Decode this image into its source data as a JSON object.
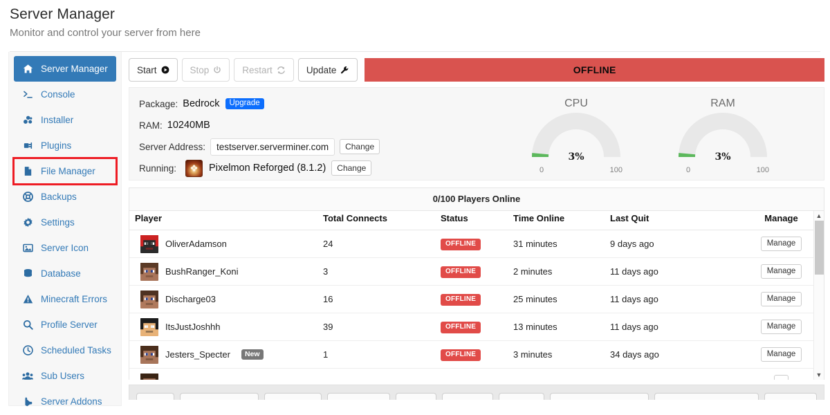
{
  "header": {
    "title": "Server Manager",
    "subtitle": "Monitor and control your server from here"
  },
  "sidebar": {
    "items": [
      {
        "label": "Server Manager",
        "icon": "home-icon",
        "state": "active"
      },
      {
        "label": "Console",
        "icon": "terminal-icon",
        "state": "normal"
      },
      {
        "label": "Installer",
        "icon": "cubes-icon",
        "state": "normal"
      },
      {
        "label": "Plugins",
        "icon": "plug-icon",
        "state": "normal"
      },
      {
        "label": "File Manager",
        "icon": "file-icon",
        "state": "flagged"
      },
      {
        "label": "Backups",
        "icon": "lifebuoy-icon",
        "state": "normal"
      },
      {
        "label": "Settings",
        "icon": "gear-icon",
        "state": "normal"
      },
      {
        "label": "Server Icon",
        "icon": "image-icon",
        "state": "normal"
      },
      {
        "label": "Database",
        "icon": "database-icon",
        "state": "normal"
      },
      {
        "label": "Minecraft Errors",
        "icon": "warning-icon",
        "state": "normal"
      },
      {
        "label": "Profile Server",
        "icon": "search-icon",
        "state": "normal"
      },
      {
        "label": "Scheduled Tasks",
        "icon": "clock-icon",
        "state": "normal"
      },
      {
        "label": "Sub Users",
        "icon": "users-icon",
        "state": "normal"
      },
      {
        "label": "Server Addons",
        "icon": "puzzle-icon",
        "state": "normal"
      }
    ]
  },
  "toolbar": {
    "start_label": "Start",
    "stop_label": "Stop",
    "restart_label": "Restart",
    "update_label": "Update",
    "status_text": "OFFLINE",
    "status_color": "#d9534f"
  },
  "info": {
    "package_label": "Package:",
    "package_value": "Bedrock",
    "upgrade_badge": "Upgrade",
    "ram_label": "RAM:",
    "ram_value": "10240MB",
    "address_label": "Server Address:",
    "address_value": "testserver.serverminer.com",
    "address_change_label": "Change",
    "running_label": "Running:",
    "running_value": "Pixelmon Reforged (8.1.2)",
    "running_change_label": "Change"
  },
  "gauges": [
    {
      "title": "CPU",
      "value": "3%",
      "percent": 3,
      "min_label": "0",
      "max_label": "100",
      "color": "#5cb85c"
    },
    {
      "title": "RAM",
      "value": "3%",
      "percent": 3,
      "min_label": "0",
      "max_label": "100",
      "color": "#5cb85c"
    }
  ],
  "players": {
    "online_summary": "0/100 Players Online",
    "columns": [
      "Player",
      "Total Connects",
      "Status",
      "Time Online",
      "Last Quit",
      "Manage"
    ],
    "manage_label": "Manage",
    "rows": [
      {
        "name": "OliverAdamson",
        "badge": "",
        "connects": "24",
        "status": "OFFLINE",
        "time_online": "31 minutes",
        "last_quit": "9 days ago",
        "skin": [
          "#2b2b2b",
          "#cc2222",
          "#4a4a4a"
        ]
      },
      {
        "name": "BushRanger_Koni",
        "badge": "",
        "connects": "3",
        "status": "OFFLINE",
        "time_online": "2 minutes",
        "last_quit": "11 days ago",
        "skin": [
          "#a9745a",
          "#5b3a26",
          "#2b3f8c"
        ]
      },
      {
        "name": "Discharge03",
        "badge": "",
        "connects": "16",
        "status": "OFFLINE",
        "time_online": "25 minutes",
        "last_quit": "11 days ago",
        "skin": [
          "#b07a5d",
          "#4e3222",
          "#2b3f8c"
        ]
      },
      {
        "name": "ItsJustJoshhh",
        "badge": "",
        "connects": "39",
        "status": "OFFLINE",
        "time_online": "13 minutes",
        "last_quit": "11 days ago",
        "skin": [
          "#e8b277",
          "#1c1c1c",
          "#f0f0f0"
        ]
      },
      {
        "name": "Jesters_Specter",
        "badge": "New",
        "connects": "1",
        "status": "OFFLINE",
        "time_online": "3 minutes",
        "last_quit": "34 days ago",
        "skin": [
          "#a8755a",
          "#4b2e1c",
          "#2b3f8c"
        ]
      }
    ]
  }
}
